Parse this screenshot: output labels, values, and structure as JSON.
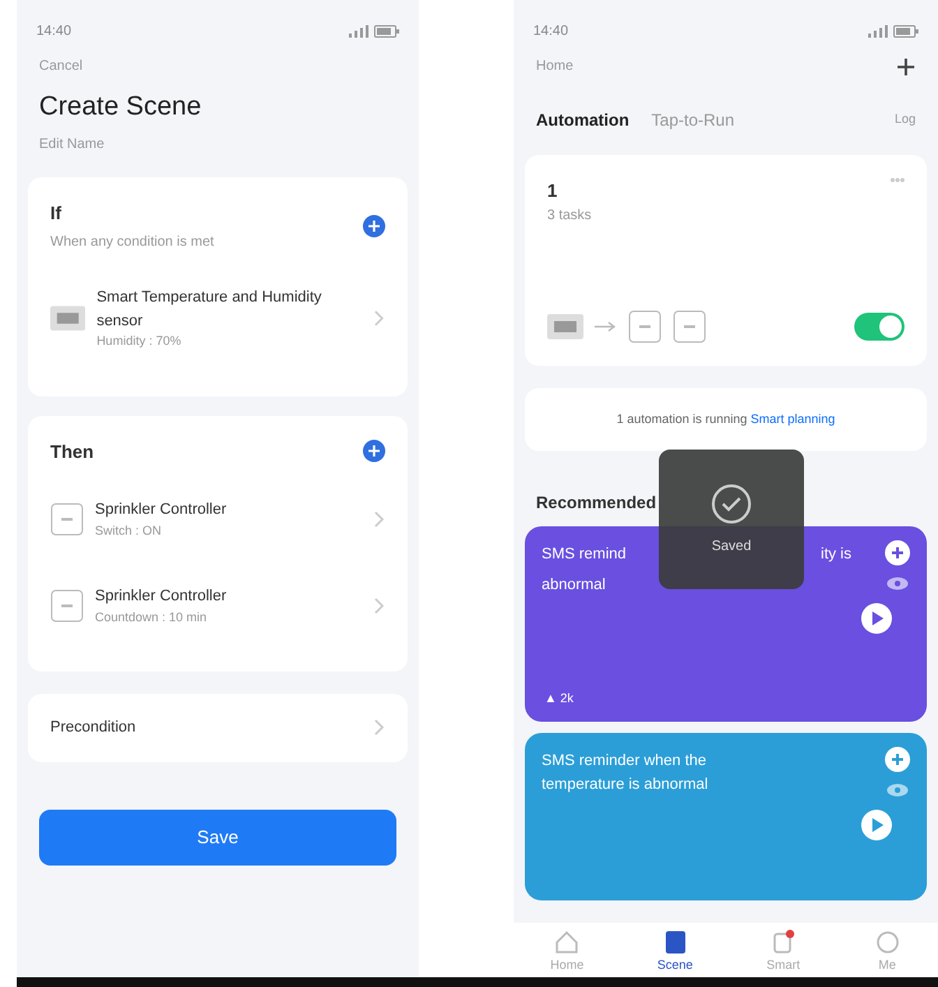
{
  "left_screen": {
    "status_time": "14:40",
    "back": "Cancel",
    "title": "Create Scene",
    "subtitle": "Edit Name",
    "if_section": {
      "title": "If",
      "subtitle": "When any condition is met",
      "items": [
        {
          "kind": "sensor",
          "name": "Smart Temperature and Humidity sensor",
          "detail": "Humidity : 70%"
        }
      ]
    },
    "then_section": {
      "title": "Then",
      "items": [
        {
          "kind": "controller",
          "name": "Sprinkler Controller",
          "detail": "Switch : ON"
        },
        {
          "kind": "controller",
          "name": "Sprinkler Controller",
          "detail": "Countdown : 10 min"
        }
      ]
    },
    "precondition": "Precondition",
    "save_button": "Save"
  },
  "right_screen": {
    "status_time": "14:40",
    "home": "Home",
    "tabs": [
      {
        "label": "Automation",
        "selected": true
      },
      {
        "label": "Tap-to-Run",
        "selected": false
      }
    ],
    "log": "Log",
    "automation": {
      "name": "1",
      "count": "3 tasks",
      "on": true
    },
    "info": {
      "text": "1 automation is running",
      "link": "Smart planning"
    },
    "toast": "Saved",
    "recommended_title": "Recommended",
    "recommendations": [
      {
        "title_pieces": [
          "SMS remind",
          "ity is",
          "abnormal"
        ],
        "color": "#6a4fe0",
        "footer": "▲ 2k"
      },
      {
        "title": "SMS reminder when the temperature is abnormal",
        "color": "#2b9ed8"
      }
    ],
    "nav": [
      {
        "label": "Home",
        "selected": false
      },
      {
        "label": "Scene",
        "selected": true
      },
      {
        "label": "Smart",
        "selected": false
      },
      {
        "label": "Me",
        "selected": false
      }
    ]
  }
}
